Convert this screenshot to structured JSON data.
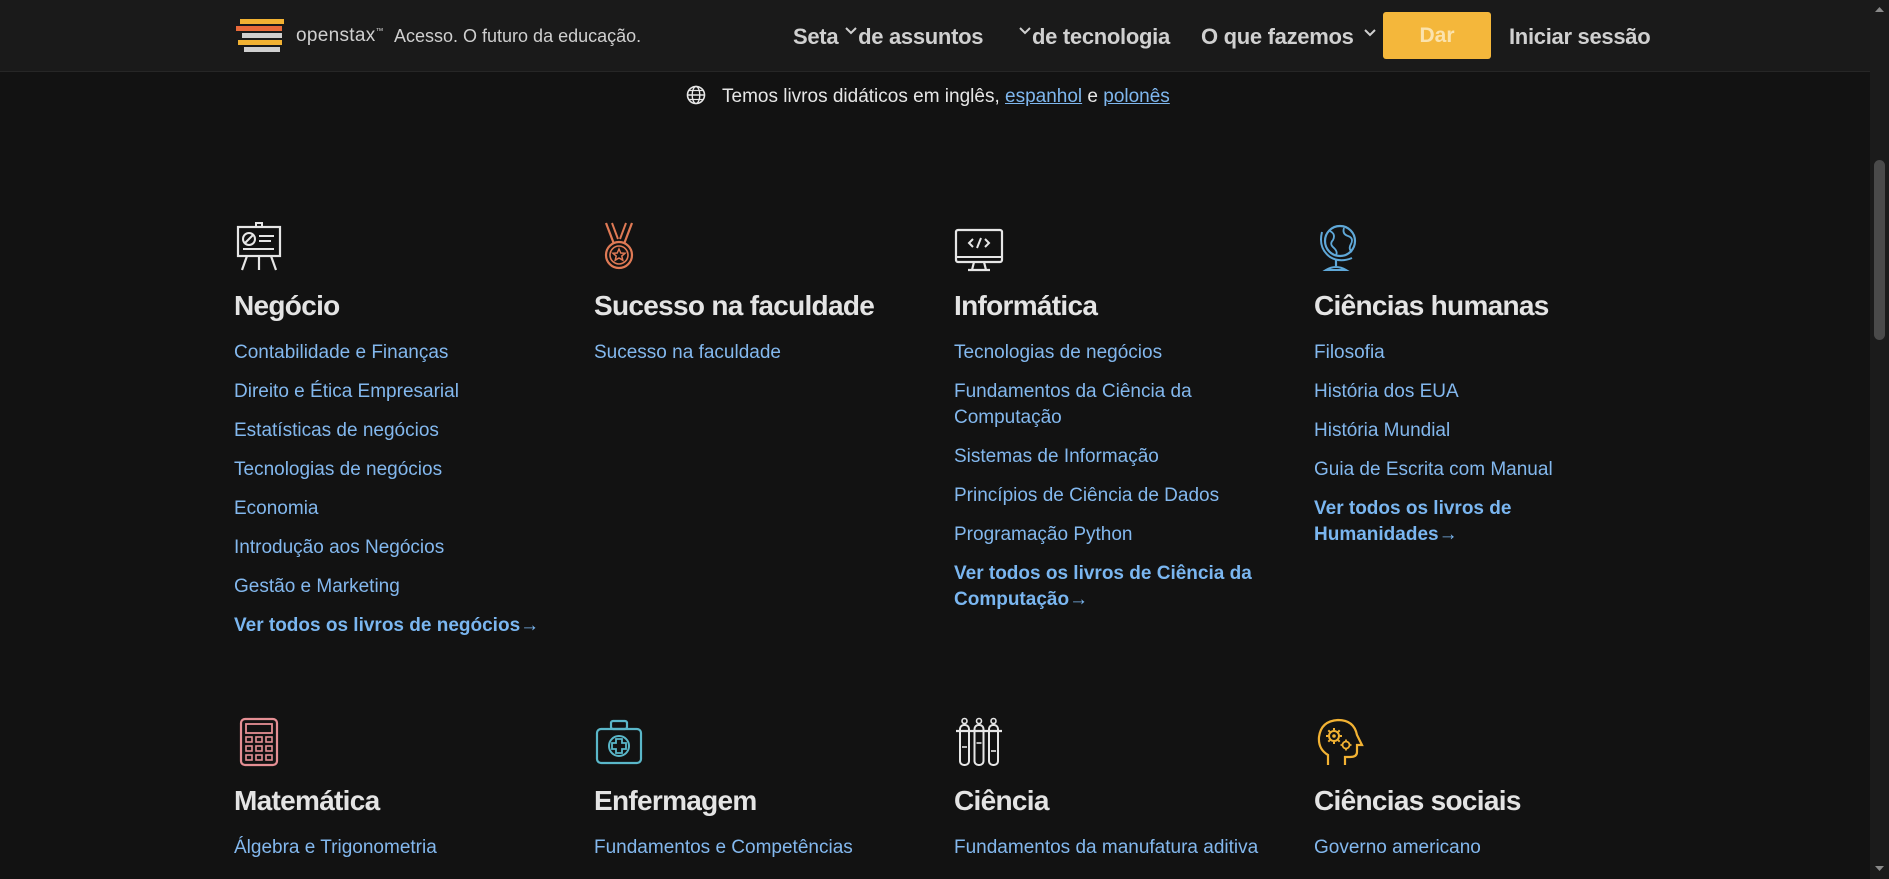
{
  "header": {
    "brand": "openstax",
    "brand_tm": "™",
    "tagline": "Acesso. O futuro da educação.",
    "nav": [
      {
        "label": "Seta",
        "icon": "chevron-down-icon"
      },
      {
        "label": "de assuntos"
      },
      {
        "label": "de tecnologia",
        "icon": "chevron-down-icon"
      },
      {
        "label": "O que fazemos",
        "icon": "chevron-down-icon"
      }
    ],
    "give_label": "Dar",
    "login_label": "Iniciar sessão"
  },
  "language_notice": {
    "icon": "globe-icon",
    "prefix": "Temos livros didáticos em inglês, ",
    "link1": "espanhol",
    "middle": " e ",
    "link2": "polonês"
  },
  "subjects": [
    {
      "title": "Negócio",
      "icon": "presentation-board-icon",
      "links": [
        "Contabilidade e Finanças",
        "Direito e Ética Empresarial",
        "Estatísticas de negócios",
        "Tecnologias de negócios",
        "Economia",
        "Introdução aos Negócios",
        "Gestão e Marketing"
      ],
      "more": "Ver todos os livros de negócios→"
    },
    {
      "title": "Sucesso na faculdade",
      "icon": "medal-icon",
      "links": [
        "Sucesso na faculdade"
      ],
      "more": ""
    },
    {
      "title": "Informática",
      "icon": "code-monitor-icon",
      "links": [
        "Tecnologias de negócios",
        "Fundamentos da Ciência da Computação",
        "Sistemas de Informação",
        "Princípios de Ciência de Dados",
        "Programação Python"
      ],
      "more": "Ver todos os livros de Ciência da Computação→"
    },
    {
      "title": "Ciências humanas",
      "icon": "globe-stand-icon",
      "links": [
        "Filosofia",
        "História dos EUA",
        "História Mundial",
        "Guia de Escrita com Manual"
      ],
      "more": "Ver todos os livros de Humanidades→"
    },
    {
      "title": "Matemática",
      "icon": "calculator-icon",
      "links": [
        "Álgebra e Trigonometria"
      ],
      "more": ""
    },
    {
      "title": "Enfermagem",
      "icon": "medical-kit-icon",
      "links": [
        "Fundamentos e Competências"
      ],
      "more": ""
    },
    {
      "title": "Ciência",
      "icon": "test-tubes-icon",
      "links": [
        "Fundamentos da manufatura aditiva"
      ],
      "more": ""
    },
    {
      "title": "Ciências sociais",
      "icon": "head-gears-icon",
      "links": [
        "Governo americano"
      ],
      "more": ""
    }
  ],
  "colors": {
    "background": "#121212",
    "link": "#83b8ee",
    "give_button": "#f4b73b",
    "medal_icon": "#e07a55",
    "globe_icon": "#5fa8d8",
    "calculator_icon": "#e58f94",
    "medical_kit_icon": "#5ab7c9",
    "head_icon": "#f2b233"
  }
}
